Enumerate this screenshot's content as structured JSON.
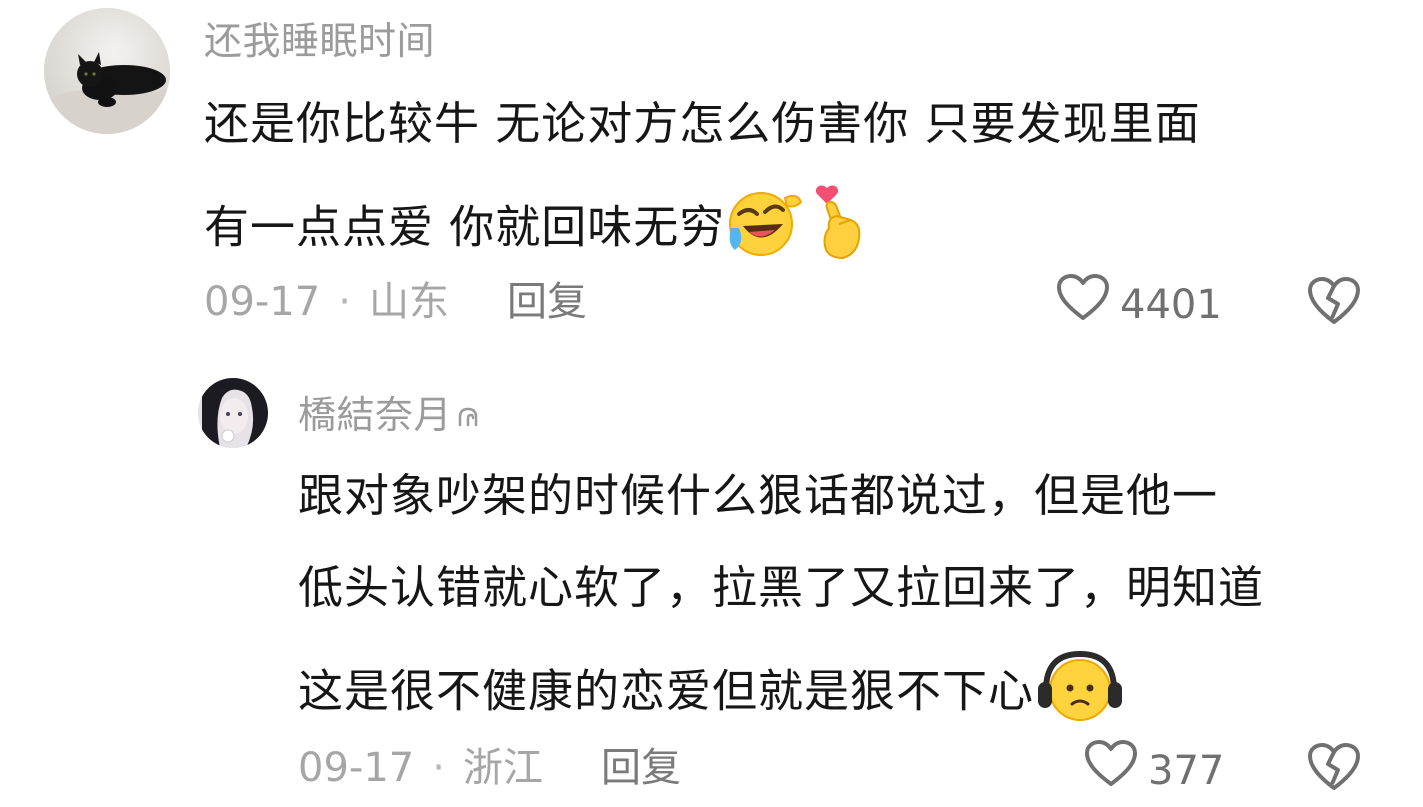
{
  "comments": [
    {
      "username": "还我睡眠时间",
      "lines": [
        "还是你比较牛 无论对方怎么伤害你 只要发现里面",
        "有一点点爱 你就回味无穷"
      ],
      "date": "09-17",
      "location": "山东",
      "reply_label": "回复",
      "likes": "4401",
      "emojis": [
        "laughing-crying-emoji",
        "finger-heart-emoji"
      ],
      "avatar": "black-cat-avatar"
    },
    {
      "username": "橋結奈月",
      "lines": [
        "跟对象吵架的时候什么狠话都说过，但是他一",
        "低头认错就心软了，拉黑了又拉回来了，明知道",
        "这是很不健康的恋爱但就是狠不下心"
      ],
      "date": "09-17",
      "location": "浙江",
      "reply_label": "回复",
      "likes": "377",
      "emojis": [
        "headphones-face-emoji"
      ],
      "avatar": "anime-girl-avatar"
    }
  ],
  "icons": {
    "like": "heart-outline-icon",
    "dislike": "broken-heart-icon",
    "author_tag": "small-curl-icon"
  },
  "colors": {
    "username": "#9b9b9b",
    "text": "#161616",
    "meta": "#a6a6a6",
    "reply": "#7a7a7a",
    "icon": "#707070"
  }
}
